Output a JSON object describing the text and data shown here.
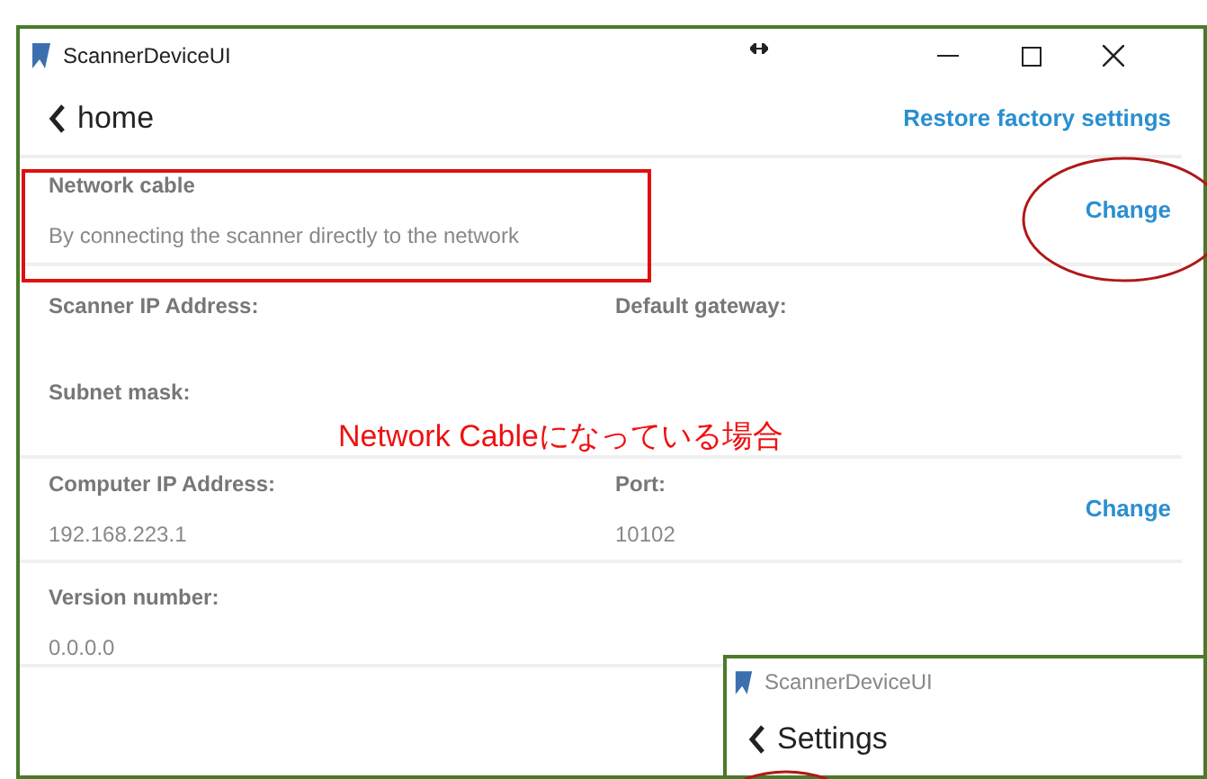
{
  "window": {
    "title": "ScannerDeviceUI",
    "back": "home",
    "action": "Restore factory settings"
  },
  "connection": {
    "label": "Network cable",
    "description": "By connecting the scanner directly to the network",
    "button": "Change"
  },
  "network_fields": [
    {
      "label": "Scanner IP Address:"
    },
    {
      "label": "Default gateway:"
    },
    {
      "label": "Subnet mask:"
    }
  ],
  "computer": {
    "fields": [
      {
        "label": "Computer IP Address:",
        "value": "192.168.223.1"
      },
      {
        "label": "Port:",
        "value": "10102"
      }
    ],
    "button": "Change"
  },
  "version": {
    "label": "Version number:",
    "value": "0.0.0.0"
  },
  "annotation": "Network Cableになっている場合",
  "second_window": {
    "title": "ScannerDeviceUI",
    "back": "Settings"
  }
}
